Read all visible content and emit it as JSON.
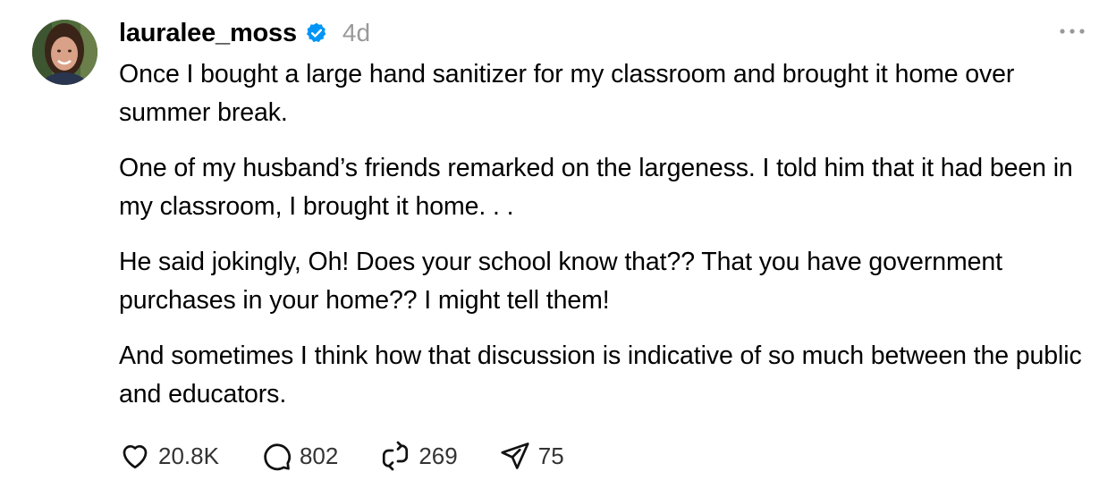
{
  "post": {
    "username": "lauralee_moss",
    "verified": true,
    "timestamp": "4d",
    "paragraphs": [
      "Once I bought a large hand sanitizer for my classroom and brought it home over summer break.",
      "One of my husband’s friends remarked on the largeness. I told him that it had been in my classroom, I brought it home. . .",
      "He said jokingly, Oh! Does your school know that?? That you have government purchases in your home?? I might tell them!",
      "And sometimes I think how that discussion is indicative of so much between the public and educators."
    ]
  },
  "actions": {
    "likes": "20.8K",
    "comments": "802",
    "reposts": "269",
    "shares": "75"
  },
  "icons": {
    "verified": "verified-badge-icon",
    "more": "more-options-icon",
    "like": "heart-icon",
    "comment": "comment-bubble-icon",
    "repost": "repost-icon",
    "share": "send-paper-plane-icon"
  },
  "colors": {
    "verified_blue": "#0095f6",
    "timestamp_gray": "#999999",
    "text": "#000000"
  }
}
